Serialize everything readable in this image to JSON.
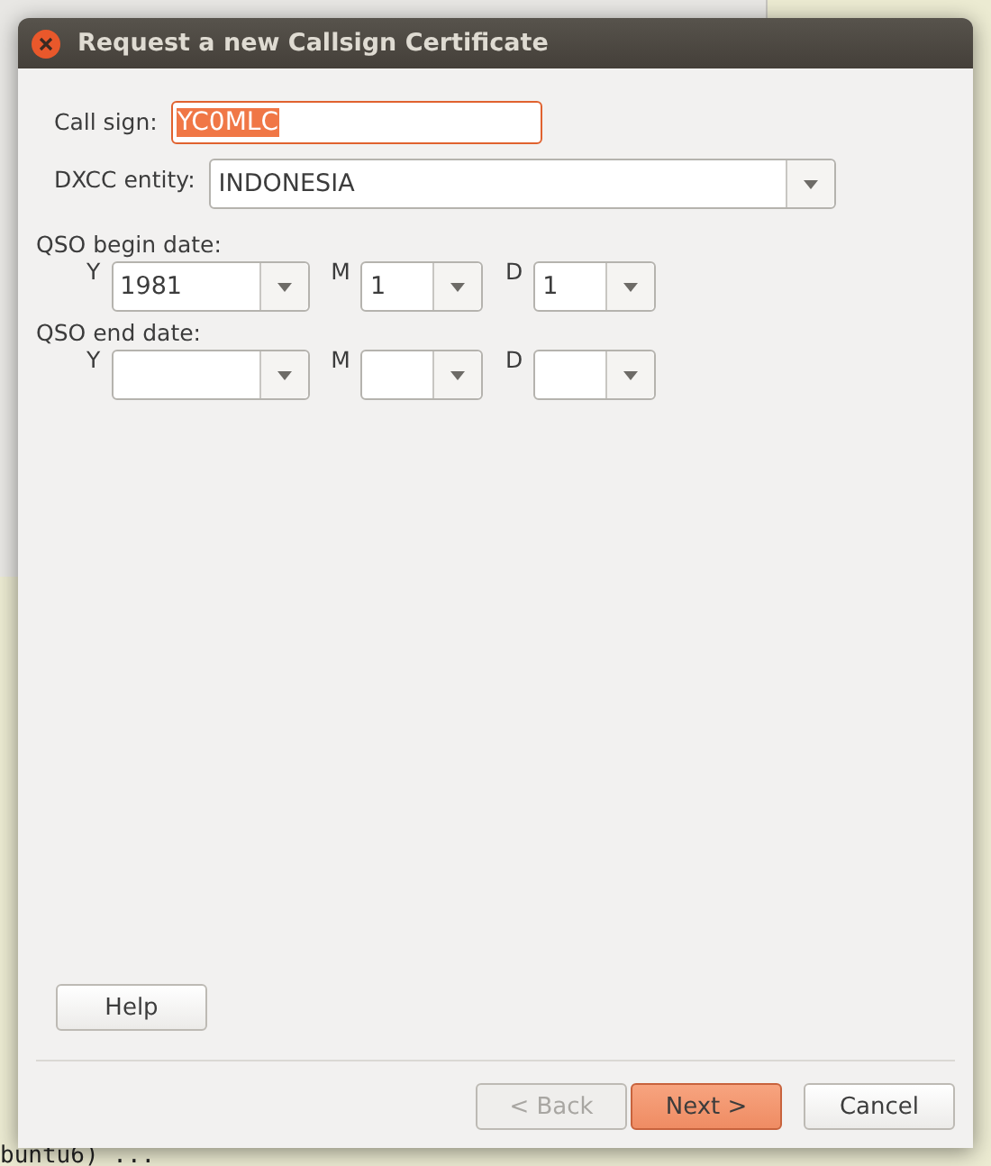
{
  "background": {
    "terminal_lines": [
      "buntu6) ..."
    ]
  },
  "window": {
    "title": "Request a new Callsign Certificate"
  },
  "call_sign": {
    "label": "Call sign:",
    "value": "YC0MLC",
    "focused": true,
    "text_selected": true
  },
  "dxcc": {
    "label": "DXCC entity:",
    "value": "INDONESIA"
  },
  "date_groups": [
    {
      "label": "QSO begin date:",
      "parts": [
        {
          "label": "Y",
          "value": "1981",
          "kind": "year"
        },
        {
          "label": "M",
          "value": "1",
          "kind": "small"
        },
        {
          "label": "D",
          "value": "1",
          "kind": "small"
        }
      ]
    },
    {
      "label": "QSO end date:",
      "parts": [
        {
          "label": "Y",
          "kind": "year"
        },
        {
          "label": "M",
          "kind": "small"
        },
        {
          "label": "D",
          "kind": "small"
        }
      ]
    }
  ],
  "help_button": {
    "label": "Help"
  },
  "buttons": [
    {
      "label": "< Back",
      "disabled": true,
      "default": false
    },
    {
      "label": "Next >",
      "disabled": false,
      "default": true
    },
    {
      "label": "Cancel",
      "disabled": false,
      "default": false
    }
  ]
}
